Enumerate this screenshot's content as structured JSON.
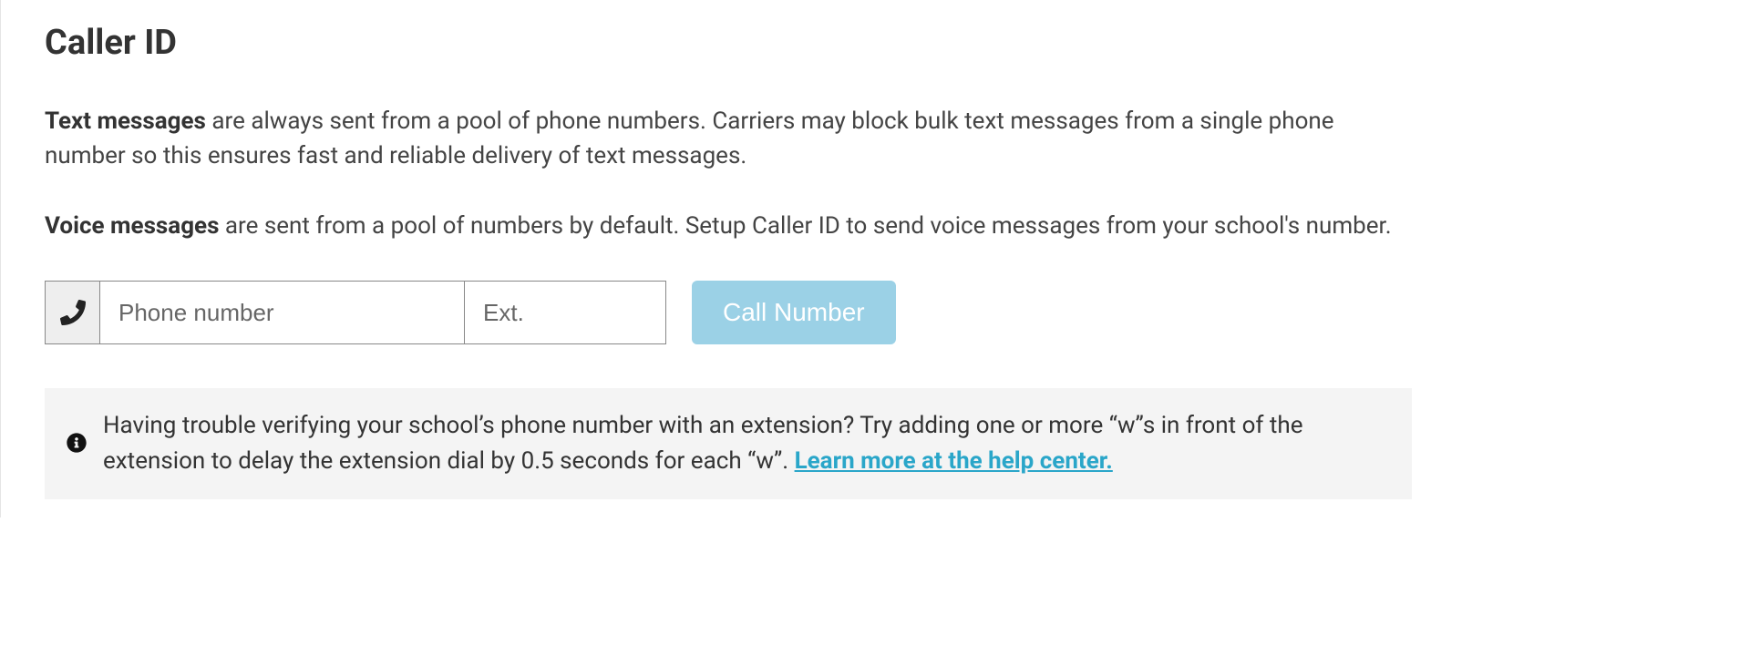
{
  "header": {
    "title": "Caller ID"
  },
  "paragraphs": {
    "text_strong": "Text messages",
    "text_body": " are always sent from a pool of phone numbers. Carriers may block bulk text messages from a single phone number so this ensures fast and reliable delivery of text messages.",
    "voice_strong": "Voice messages",
    "voice_body": " are sent from a pool of numbers by default. Setup Caller ID to send voice messages from your school's number."
  },
  "form": {
    "phone_placeholder": "Phone number",
    "ext_placeholder": "Ext.",
    "call_button": "Call Number"
  },
  "info": {
    "text": "Having trouble verifying your school’s phone number with an extension? Try adding one or more “w”s in front of the extension to delay the extension dial by 0.5 seconds for each “w”. ",
    "link": "Learn more at the help center."
  }
}
